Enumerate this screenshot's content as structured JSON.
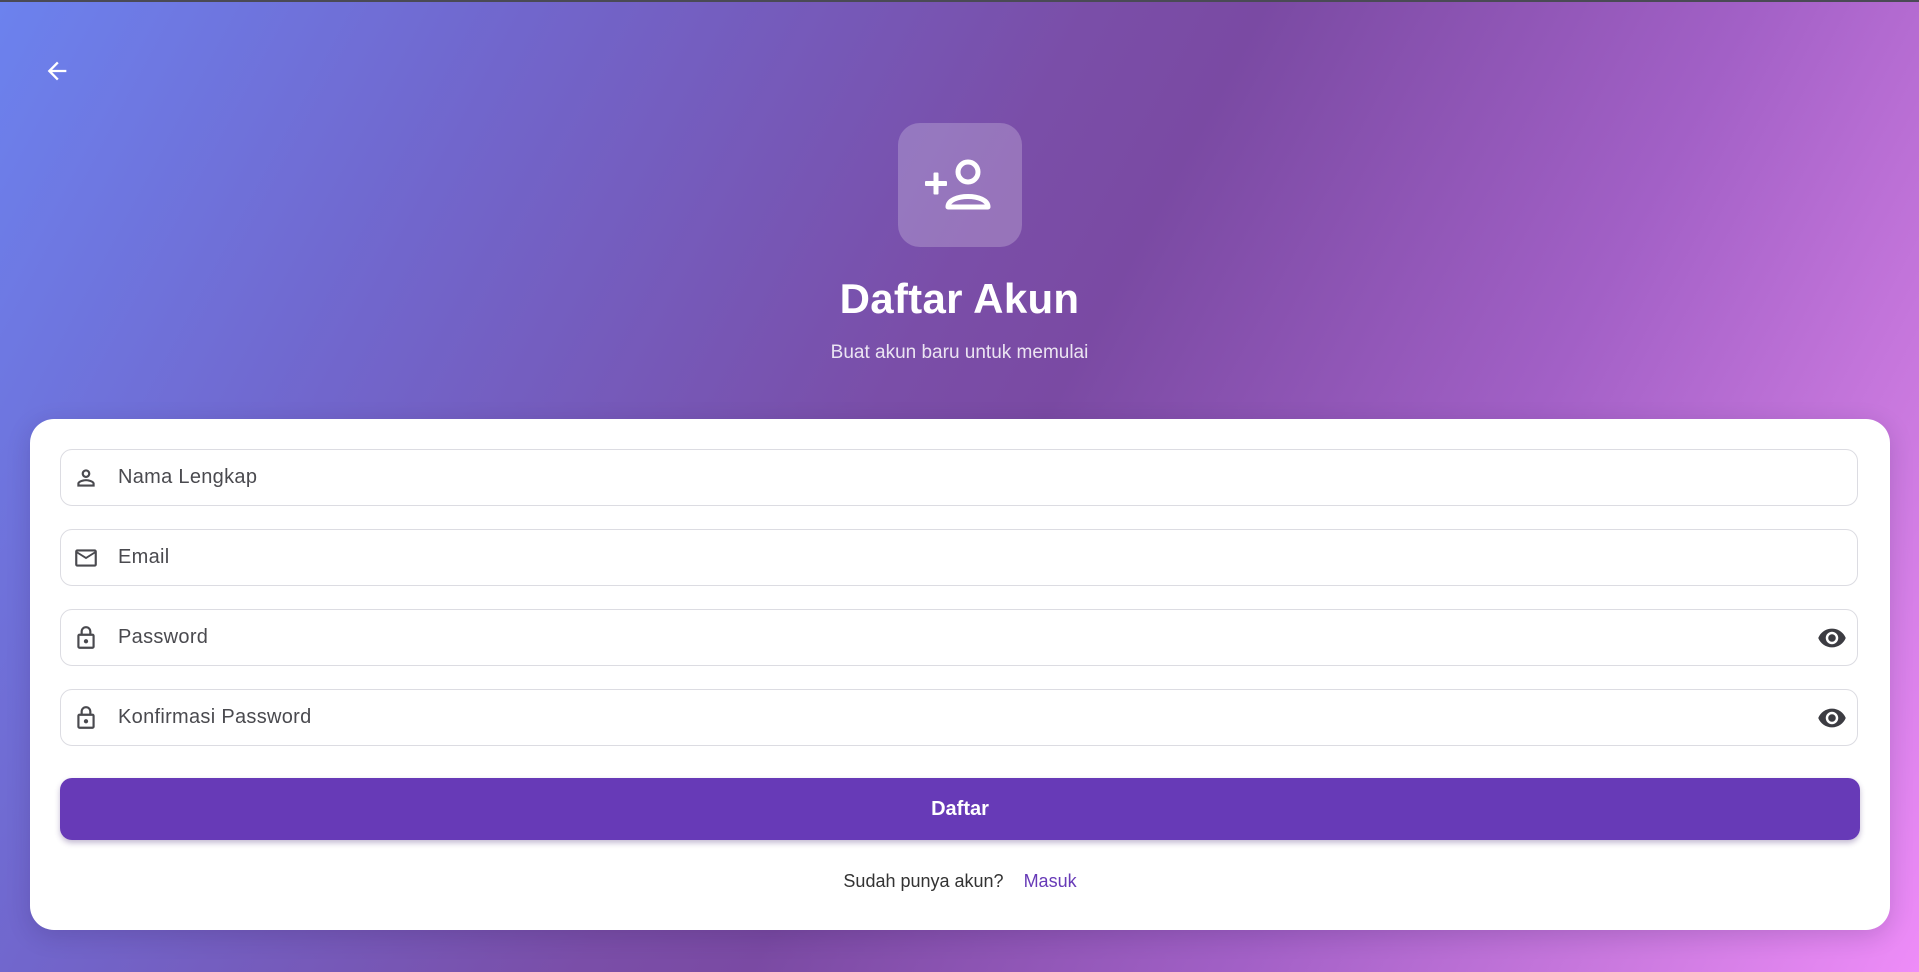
{
  "colors": {
    "accent": "#673ab7",
    "card_background": "#ffffff",
    "field_border": "#dcdce2",
    "icon_gray": "#4a4a4f"
  },
  "nav": {
    "back_icon": "arrow-left-icon"
  },
  "header": {
    "icon": "person-add-icon",
    "title": "Daftar Akun",
    "subtitle": "Buat akun baru untuk memulai"
  },
  "form": {
    "fields": [
      {
        "icon": "person-icon",
        "placeholder": "Nama Lengkap",
        "value": ""
      },
      {
        "icon": "mail-icon",
        "placeholder": "Email",
        "value": ""
      },
      {
        "icon": "lock-icon",
        "placeholder": "Password",
        "value": "",
        "trailing_icon": "eye-icon"
      },
      {
        "icon": "lock-icon",
        "placeholder": "Konfirmasi Password",
        "value": "",
        "trailing_icon": "eye-icon"
      }
    ],
    "submit_label": "Daftar",
    "login_prompt": "Sudah punya akun?",
    "login_link": "Masuk"
  }
}
